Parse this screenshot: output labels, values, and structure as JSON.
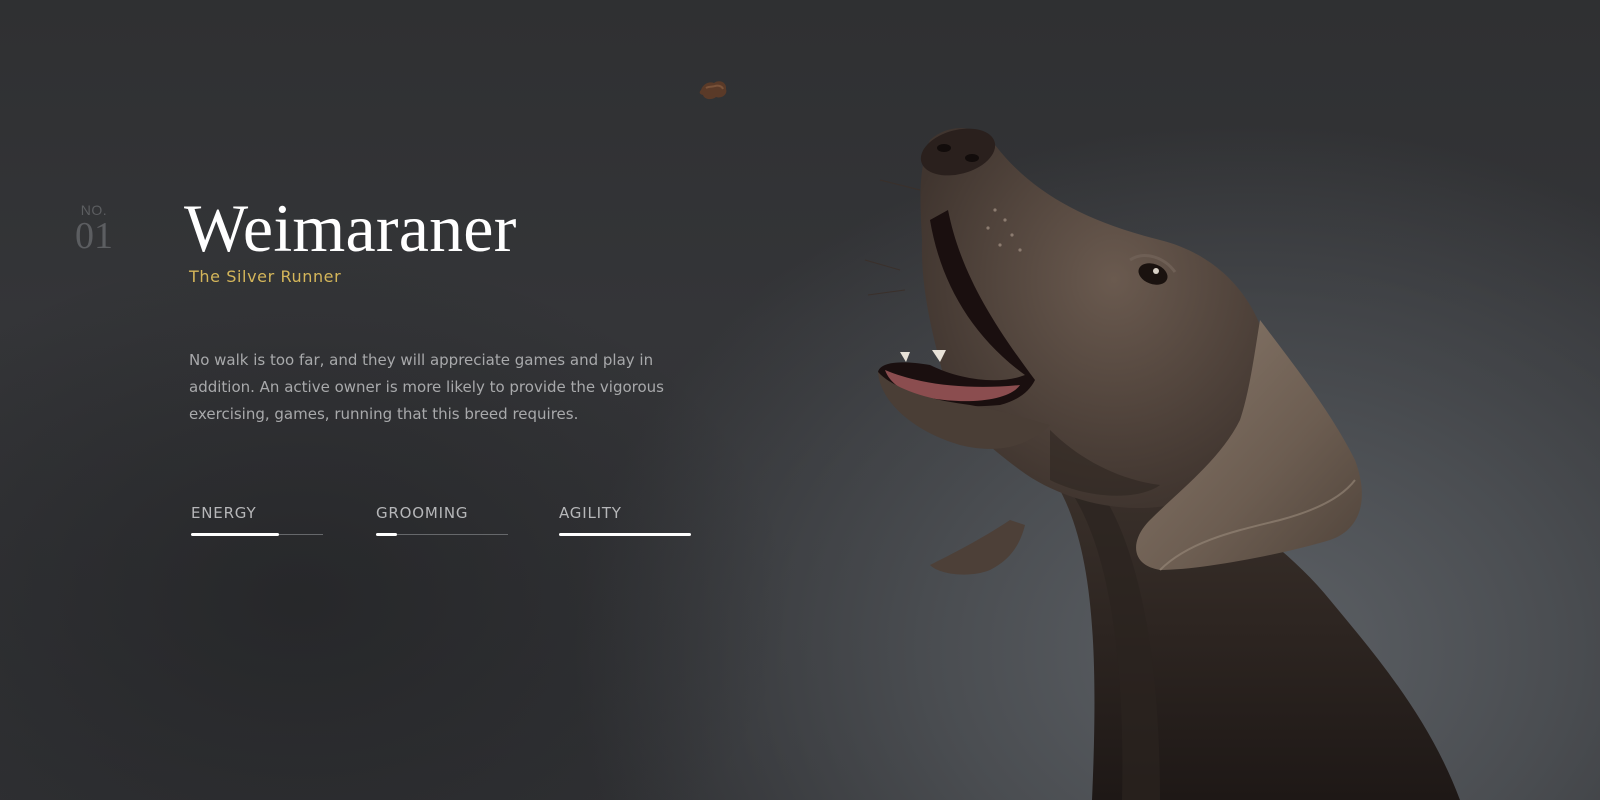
{
  "breed": {
    "number_label": "NO.",
    "number": "01",
    "title": "Weimaraner",
    "subtitle": "The Silver Runner",
    "description": "No walk is too far, and they will appreciate games and play in addition. An active owner is more likely to provide the vigorous exercising, games, running that this breed requires."
  },
  "stats": [
    {
      "label": "ENERGY",
      "level": 0.67
    },
    {
      "label": "GROOMING",
      "level": 0.16
    },
    {
      "label": "AGILITY",
      "level": 1.0
    }
  ],
  "colors": {
    "background": "#2c2d2f",
    "title": "#ffffff",
    "accent": "#d4b65a",
    "body_text": "#a8a9ab",
    "bar_fill": "#ffffff",
    "bar_track": "#66686b"
  },
  "images": {
    "hero": "weimaraner-dog-photo",
    "treat": "dog-treat"
  }
}
